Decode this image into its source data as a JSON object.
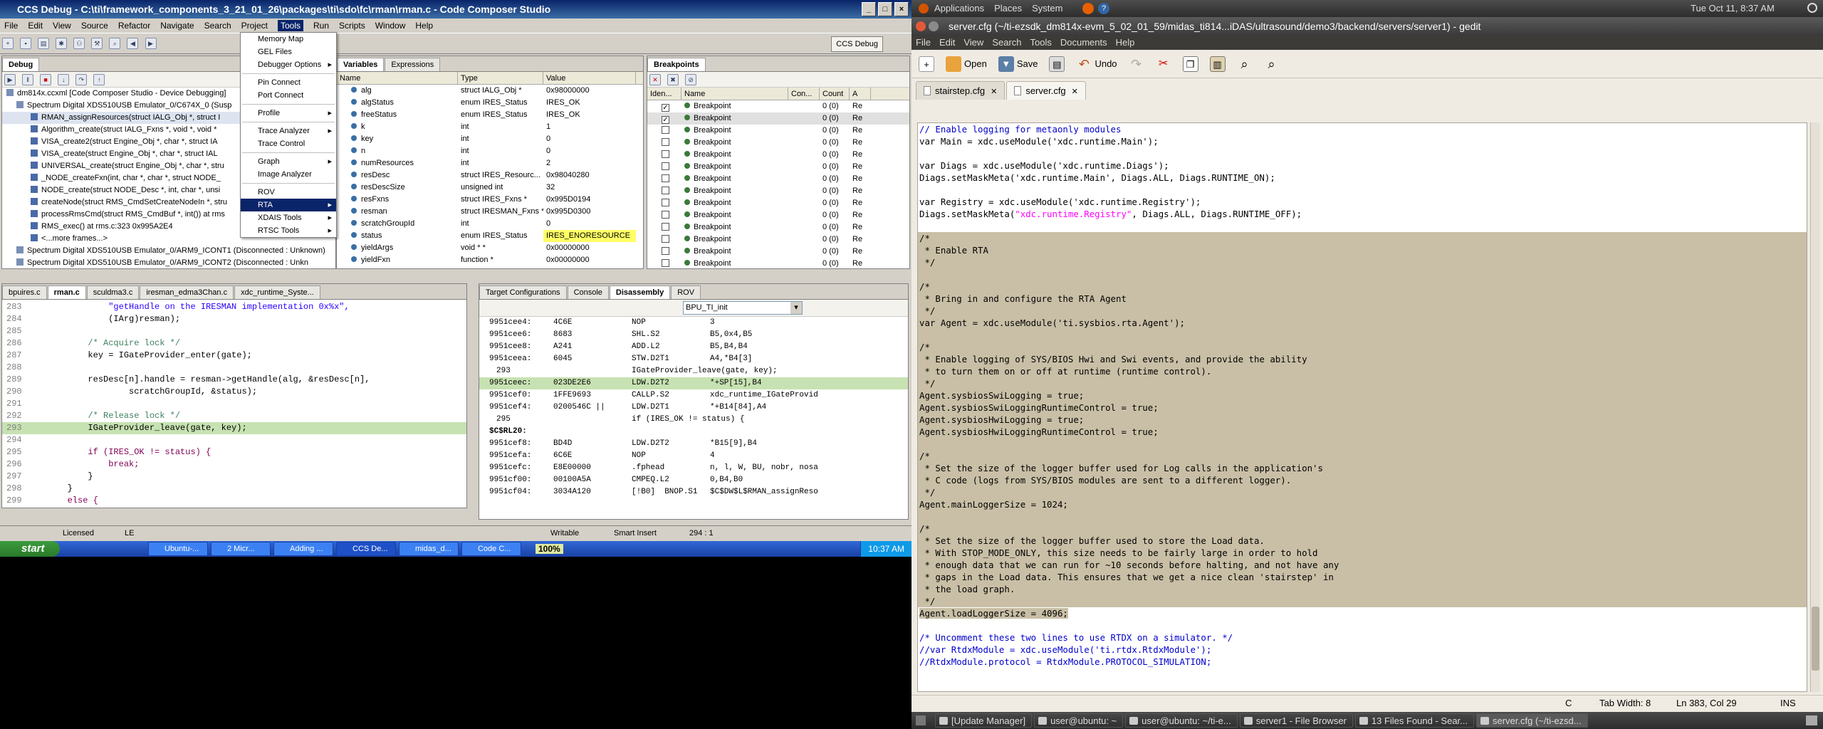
{
  "ccs": {
    "title": "CCS Debug - C:\\ti\\framework_components_3_21_01_26\\packages\\ti\\sdo\\fc\\rman\\rman.c - Code Composer Studio",
    "menu": [
      "File",
      "Edit",
      "View",
      "Source",
      "Refactor",
      "Navigate",
      "Search",
      "Project",
      "Tools",
      "Run",
      "Scripts",
      "Window",
      "Help"
    ],
    "perspective": "CCS Debug",
    "tools_menu": [
      "Memory Map",
      "GEL Files",
      "Debugger Options",
      "Pin Connect",
      "Port Connect",
      "Profile",
      "Trace Analyzer",
      "Trace Control",
      "Graph",
      "Image Analyzer",
      "ROV",
      "RTA",
      "XDAIS Tools",
      "RTSC Tools"
    ],
    "debug_tab": "Debug",
    "debug_tree": [
      "dm814x.ccxml [Code Composer Studio - Device Debugging]",
      "Spectrum Digital XDS510USB Emulator_0/C674X_0 (Susp",
      "RMAN_assignResources(struct IALG_Obj *, struct I",
      "Algorithm_create(struct IALG_Fxns *, void *, void *",
      "VISA_create2(struct Engine_Obj *, char *, struct IA",
      "VISA_create(struct Engine_Obj *, char *, struct IAL",
      "UNIVERSAL_create(struct Engine_Obj *, char *, stru",
      "_NODE_createFxn(int, char *, char *, struct NODE_",
      "NODE_create(struct NODE_Desc *, int, char *, unsi",
      "createNode(struct RMS_CmdSetCreateNodeIn *, stru",
      "processRmsCmd(struct RMS_CmdBuf *, int()) at rms",
      "RMS_exec() at rms.c:323 0x995A2E4",
      "<...more frames...>",
      "Spectrum Digital XDS510USB Emulator_0/ARM9_ICONT1 (Disconnected : Unknown)",
      "Spectrum Digital XDS510USB Emulator_0/ARM9_ICONT2 (Disconnected : Unkn"
    ],
    "var_tabs": [
      "Variables",
      "Expressions"
    ],
    "var_headers": [
      "Name",
      "Type",
      "Value"
    ],
    "variables": [
      {
        "name": "alg",
        "type": "struct IALG_Obj *",
        "value": "0x98000000"
      },
      {
        "name": "algStatus",
        "type": "enum IRES_Status",
        "value": "IRES_OK"
      },
      {
        "name": "freeStatus",
        "type": "enum IRES_Status",
        "value": "IRES_OK"
      },
      {
        "name": "k",
        "type": "int",
        "value": "1"
      },
      {
        "name": "key",
        "type": "int",
        "value": "0"
      },
      {
        "name": "n",
        "type": "int",
        "value": "0"
      },
      {
        "name": "numResources",
        "type": "int",
        "value": "2"
      },
      {
        "name": "resDesc",
        "type": "struct IRES_Resourc...",
        "value": "0x98040280"
      },
      {
        "name": "resDescSize",
        "type": "unsigned int",
        "value": "32"
      },
      {
        "name": "resFxns",
        "type": "struct IRES_Fxns *",
        "value": "0x995D0194"
      },
      {
        "name": "resman",
        "type": "struct IRESMAN_Fxns *",
        "value": "0x995D0300"
      },
      {
        "name": "scratchGroupId",
        "type": "int",
        "value": "0"
      },
      {
        "name": "status",
        "type": "enum IRES_Status",
        "value": "IRES_ENORESOURCE"
      },
      {
        "name": "yieldArgs",
        "type": "void * *",
        "value": "0x00000000"
      },
      {
        "name": "yieldFxn",
        "type": "function *",
        "value": "0x00000000"
      }
    ],
    "bp_tab": "Breakpoints",
    "bp_headers": [
      "Iden...",
      "Name",
      "Con...",
      "Count",
      "A"
    ],
    "breakpoints": [
      {
        "name": "Breakpoint",
        "count": "0 (0)",
        "a": "Re",
        "checked": true
      },
      {
        "name": "Breakpoint",
        "count": "0 (0)",
        "a": "Re",
        "checked": true
      },
      {
        "name": "Breakpoint",
        "count": "0 (0)",
        "a": "Re",
        "checked": false
      },
      {
        "name": "Breakpoint",
        "count": "0 (0)",
        "a": "Re",
        "checked": false
      },
      {
        "name": "Breakpoint",
        "count": "0 (0)",
        "a": "Re",
        "checked": false
      },
      {
        "name": "Breakpoint",
        "count": "0 (0)",
        "a": "Re",
        "checked": false
      },
      {
        "name": "Breakpoint",
        "count": "0 (0)",
        "a": "Re",
        "checked": false
      },
      {
        "name": "Breakpoint",
        "count": "0 (0)",
        "a": "Re",
        "checked": false
      },
      {
        "name": "Breakpoint",
        "count": "0 (0)",
        "a": "Re",
        "checked": false
      },
      {
        "name": "Breakpoint",
        "count": "0 (0)",
        "a": "Re",
        "checked": false
      },
      {
        "name": "Breakpoint",
        "count": "0 (0)",
        "a": "Re",
        "checked": false
      },
      {
        "name": "Breakpoint",
        "count": "0 (0)",
        "a": "Re",
        "checked": false
      },
      {
        "name": "Breakpoint",
        "count": "0 (0)",
        "a": "Re",
        "checked": false
      },
      {
        "name": "Breakpoint",
        "count": "0 (0)",
        "a": "Re",
        "checked": false
      }
    ],
    "editor_tabs": [
      "bpuires.c",
      "rman.c",
      "sculdma3.c",
      "iresman_edma3Chan.c",
      "xdc_runtime_Syste..."
    ],
    "editor_lines": [
      {
        "n": "283",
        "t": "                \"getHandle on the IRESMAN implementation 0x%x\",",
        "hl": false
      },
      {
        "n": "284",
        "t": "                (IArg)resman);",
        "hl": false
      },
      {
        "n": "285",
        "t": "",
        "hl": false
      },
      {
        "n": "286",
        "t": "            /* Acquire lock */",
        "hl": false
      },
      {
        "n": "287",
        "t": "            key = IGateProvider_enter(gate);",
        "hl": false
      },
      {
        "n": "288",
        "t": "",
        "hl": false
      },
      {
        "n": "289",
        "t": "            resDesc[n].handle = resman->getHandle(alg, &resDesc[n],",
        "hl": false
      },
      {
        "n": "290",
        "t": "                    scratchGroupId, &status);",
        "hl": false
      },
      {
        "n": "291",
        "t": "",
        "hl": false
      },
      {
        "n": "292",
        "t": "            /* Release lock */",
        "hl": false
      },
      {
        "n": "293",
        "t": "            IGateProvider_leave(gate, key);",
        "hl": true
      },
      {
        "n": "294",
        "t": "",
        "hl": false
      },
      {
        "n": "295",
        "t": "            if (IRES_OK != status) {",
        "hl": false
      },
      {
        "n": "296",
        "t": "                break;",
        "hl": false
      },
      {
        "n": "297",
        "t": "            }",
        "hl": false
      },
      {
        "n": "298",
        "t": "        }",
        "hl": false
      },
      {
        "n": "299",
        "t": "        else {",
        "hl": false
      }
    ],
    "dis_tabs": [
      "Target Configurations",
      "Console",
      "Disassembly",
      "ROV"
    ],
    "dis_location": "BPU_TI_init",
    "disassembly": [
      {
        "a": "9951cee4:",
        "c": "4C6E",
        "m": "NOP",
        "o": "3",
        "hl": false
      },
      {
        "a": "9951cee6:",
        "c": "8683",
        "m": "SHL.S2",
        "o": "B5,0x4,B5",
        "hl": false
      },
      {
        "a": "9951cee8:",
        "c": "A241",
        "m": "ADD.L2",
        "o": "B5,B4,B4",
        "hl": false
      },
      {
        "a": "9951ceea:",
        "c": "6045",
        "m": "STW.D2T1",
        "o": "A4,*B4[3]",
        "hl": false
      },
      {
        "a": "293",
        "c": "",
        "m": "IGateProvider_leave(gate, key);",
        "o": "",
        "hl": false
      },
      {
        "a": "9951ceec:",
        "c": "023DE2E6",
        "m": "LDW.D2T2",
        "o": "*+SP[15],B4",
        "hl": true
      },
      {
        "a": "9951cef0:",
        "c": "1FFE9693",
        "m": "CALLP.S2",
        "o": "xdc_runtime_IGateProvid",
        "hl": false
      },
      {
        "a": "9951cef4:",
        "c": "0200546C ||",
        "m": "LDW.D2T1",
        "o": "*+B14[84],A4",
        "hl": false
      },
      {
        "a": "295",
        "c": "",
        "m": "if (IRES_OK != status) {",
        "o": "",
        "hl": false
      },
      {
        "a": "$C$RL20:",
        "c": "",
        "m": "",
        "o": "",
        "hl": false
      },
      {
        "a": "9951cef8:",
        "c": "BD4D",
        "m": "LDW.D2T2",
        "o": "*B15[9],B4",
        "hl": false
      },
      {
        "a": "9951cefa:",
        "c": "6C6E",
        "m": "NOP",
        "o": "4",
        "hl": false
      },
      {
        "a": "9951cefc:",
        "c": "E8E00000",
        "m": ".fphead",
        "o": "n, l, W, BU, nobr, nosa",
        "hl": false
      },
      {
        "a": "9951cf00:",
        "c": "00100A5A",
        "m": "CMPEQ.L2",
        "o": "0,B4,B0",
        "hl": false
      },
      {
        "a": "9951cf04:",
        "c": "3034A120",
        "m": "[!B0]  BNOP.S1",
        "o": "$C$DW$L$RMAN_assignReso",
        "hl": false
      }
    ],
    "status": {
      "licensed": "Licensed",
      "le": "LE",
      "writable": "Writable",
      "insert": "Smart Insert",
      "pos": "294 : 1"
    },
    "taskbar": {
      "start": "start",
      "tasks": [
        "Ubuntu-...",
        "2 Micr...",
        "Adding ...",
        "CCS De...",
        "midas_d...",
        "Code C..."
      ],
      "zoom": "100%",
      "clock": "10:37 AM"
    }
  },
  "gnome": {
    "top_menus": [
      "Applications",
      "Places",
      "System"
    ],
    "clock": "Tue Oct 11,  8:37 AM",
    "bottom_tasks": [
      "[Update Manager]",
      "user@ubuntu: ~",
      "user@ubuntu: ~/ti-e...",
      "server1 - File Browser",
      "13 Files Found - Sear...",
      "server.cfg (~/ti-ezsd..."
    ]
  },
  "gedit": {
    "title": "server.cfg (~/ti-ezsdk_dm814x-evm_5_02_01_59/midas_ti814...iDAS/ultrasound/demo3/backend/servers/server1) - gedit",
    "menu": [
      "File",
      "Edit",
      "View",
      "Search",
      "Tools",
      "Documents",
      "Help"
    ],
    "toolbar": {
      "open": "Open",
      "save": "Save",
      "undo": "Undo"
    },
    "tabs": [
      "stairstep.cfg",
      "server.cfg"
    ],
    "status": {
      "lang": "C",
      "tab": "Tab Width: 8",
      "pos": "Ln 383, Col 29",
      "mode": "INS"
    },
    "lines": [
      {
        "t": "// Enable logging for metaonly modules",
        "c": true,
        "hl": false
      },
      {
        "t": "var Main = xdc.useModule('xdc.runtime.Main');",
        "c": false,
        "hl": false
      },
      {
        "t": "",
        "c": false,
        "hl": false
      },
      {
        "t": "var Diags = xdc.useModule('xdc.runtime.Diags');",
        "c": false,
        "hl": false
      },
      {
        "t": "Diags.setMaskMeta('xdc.runtime.Main', Diags.ALL, Diags.RUNTIME_ON);",
        "c": false,
        "hl": false
      },
      {
        "t": "",
        "c": false,
        "hl": false
      },
      {
        "t": "var Registry = xdc.useModule('xdc.runtime.Registry');",
        "c": false,
        "hl": false
      },
      {
        "t": "Diags.setMaskMeta(\"xdc.runtime.Registry\", Diags.ALL, Diags.RUNTIME_OFF);",
        "c": false,
        "hl": false
      },
      {
        "t": "",
        "c": false,
        "hl": false
      },
      {
        "t": "/*",
        "c": false,
        "hl": true
      },
      {
        "t": " * Enable RTA",
        "c": false,
        "hl": true
      },
      {
        "t": " */",
        "c": false,
        "hl": true
      },
      {
        "t": "",
        "c": false,
        "hl": true
      },
      {
        "t": "/*",
        "c": false,
        "hl": true
      },
      {
        "t": " * Bring in and configure the RTA Agent",
        "c": false,
        "hl": true
      },
      {
        "t": " */",
        "c": false,
        "hl": true
      },
      {
        "t": "var Agent = xdc.useModule('ti.sysbios.rta.Agent');",
        "c": false,
        "hl": true
      },
      {
        "t": "",
        "c": false,
        "hl": true
      },
      {
        "t": "/*",
        "c": false,
        "hl": true
      },
      {
        "t": " * Enable logging of SYS/BIOS Hwi and Swi events, and provide the ability",
        "c": false,
        "hl": true
      },
      {
        "t": " * to turn them on or off at runtime (runtime control).",
        "c": false,
        "hl": true
      },
      {
        "t": " */",
        "c": false,
        "hl": true
      },
      {
        "t": "Agent.sysbiosSwiLogging = true;",
        "c": false,
        "hl": true
      },
      {
        "t": "Agent.sysbiosSwiLoggingRuntimeControl = true;",
        "c": false,
        "hl": true
      },
      {
        "t": "Agent.sysbiosHwiLogging = true;",
        "c": false,
        "hl": true
      },
      {
        "t": "Agent.sysbiosHwiLoggingRuntimeControl = true;",
        "c": false,
        "hl": true
      },
      {
        "t": "",
        "c": false,
        "hl": true
      },
      {
        "t": "/*",
        "c": false,
        "hl": true
      },
      {
        "t": " * Set the size of the logger buffer used for Log calls in the application's",
        "c": false,
        "hl": true
      },
      {
        "t": " * C code (logs from SYS/BIOS modules are sent to a different logger).",
        "c": false,
        "hl": true
      },
      {
        "t": " */",
        "c": false,
        "hl": true
      },
      {
        "t": "Agent.mainLoggerSize = 1024;",
        "c": false,
        "hl": true
      },
      {
        "t": "",
        "c": false,
        "hl": true
      },
      {
        "t": "/*",
        "c": false,
        "hl": true
      },
      {
        "t": " * Set the size of the logger buffer used to store the Load data.",
        "c": false,
        "hl": true
      },
      {
        "t": " * With STOP_MODE_ONLY, this size needs to be fairly large in order to hold",
        "c": false,
        "hl": true
      },
      {
        "t": " * enough data that we can run for ~10 seconds before halting, and not have any",
        "c": false,
        "hl": true
      },
      {
        "t": " * gaps in the Load data. This ensures that we get a nice clean 'stairstep' in",
        "c": false,
        "hl": true
      },
      {
        "t": " * the load graph.",
        "c": false,
        "hl": true
      },
      {
        "t": " */",
        "c": false,
        "hl": true
      },
      {
        "t": "Agent.loadLoggerSize = 4096;",
        "c": false,
        "hl": "partial"
      },
      {
        "t": "",
        "c": false,
        "hl": false
      },
      {
        "t": "/* Uncomment these two lines to use RTDX on a simulator. */",
        "c": true,
        "hl": false
      },
      {
        "t": "//var RtdxModule = xdc.useModule('ti.rtdx.RtdxModule');",
        "c": true,
        "hl": false
      },
      {
        "t": "//RtdxModule.protocol = RtdxModule.PROTOCOL_SIMULATION;",
        "c": true,
        "hl": false
      }
    ]
  }
}
